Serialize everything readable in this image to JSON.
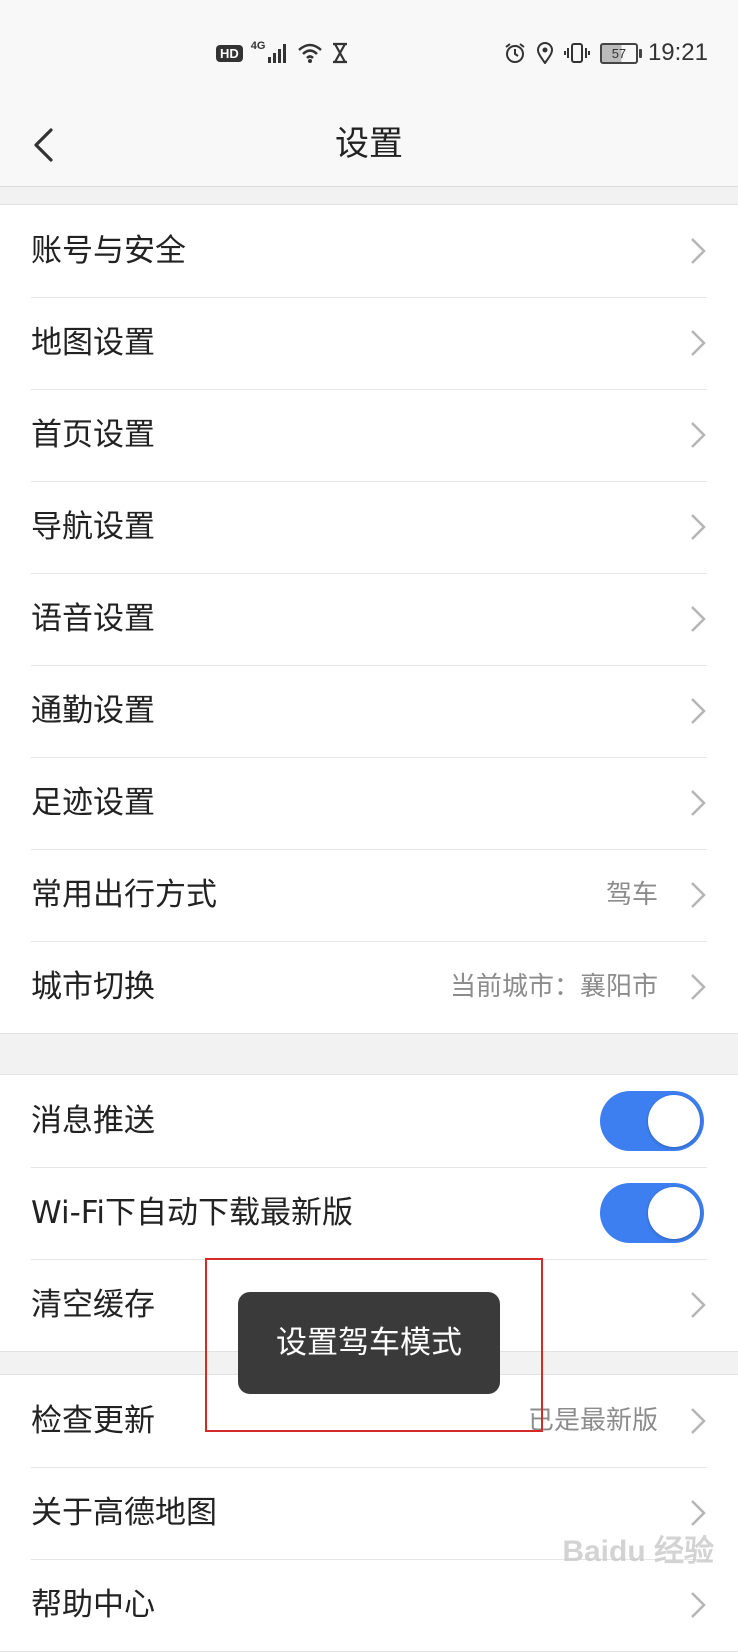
{
  "status_bar": {
    "hd_badge": "HD",
    "network": "4G",
    "battery_level": "57",
    "time": "19:21"
  },
  "header": {
    "title": "设置"
  },
  "group1": [
    {
      "label": "账号与安全",
      "value": ""
    },
    {
      "label": "地图设置",
      "value": ""
    },
    {
      "label": "首页设置",
      "value": ""
    },
    {
      "label": "导航设置",
      "value": ""
    },
    {
      "label": "语音设置",
      "value": ""
    },
    {
      "label": "通勤设置",
      "value": ""
    },
    {
      "label": "足迹设置",
      "value": ""
    },
    {
      "label": "常用出行方式",
      "value": "驾车"
    },
    {
      "label": "城市切换",
      "value": "当前城市：襄阳市"
    }
  ],
  "group2": [
    {
      "label": "消息推送",
      "toggle_on": true
    },
    {
      "label": "Wi-Fi下自动下载最新版",
      "toggle_on": true
    },
    {
      "label": "清空缓存",
      "value": ""
    }
  ],
  "group3": [
    {
      "label": "检查更新",
      "value": "已是最新版"
    },
    {
      "label": "关于高德地图",
      "value": ""
    },
    {
      "label": "帮助中心",
      "value": ""
    }
  ],
  "toast": {
    "message": "设置驾车模式"
  },
  "colors": {
    "toggle_accent": "#3d7ff0",
    "annotation_box": "#d42a2a"
  }
}
